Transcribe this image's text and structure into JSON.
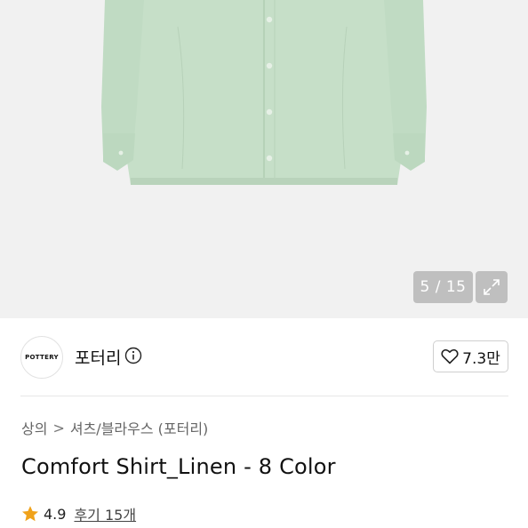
{
  "gallery": {
    "counter": "5 / 15",
    "current_page": 5,
    "total_pages": 15,
    "image_alt": "green linen shirt"
  },
  "brand": {
    "logo_text": "POTTERY",
    "name": "포터리",
    "like_count": "7.3만"
  },
  "breadcrumb": {
    "level1": "상의",
    "separator": ">",
    "level2": "셔츠/블라우스 (포터리)"
  },
  "product": {
    "title": "Comfort Shirt_Linen - 8 Color",
    "rating": "4.9",
    "reviews": "후기 15개"
  },
  "colors": {
    "shirt": "#c6dfc8",
    "star": "#f0a21a",
    "background": "#f1f1f1"
  }
}
